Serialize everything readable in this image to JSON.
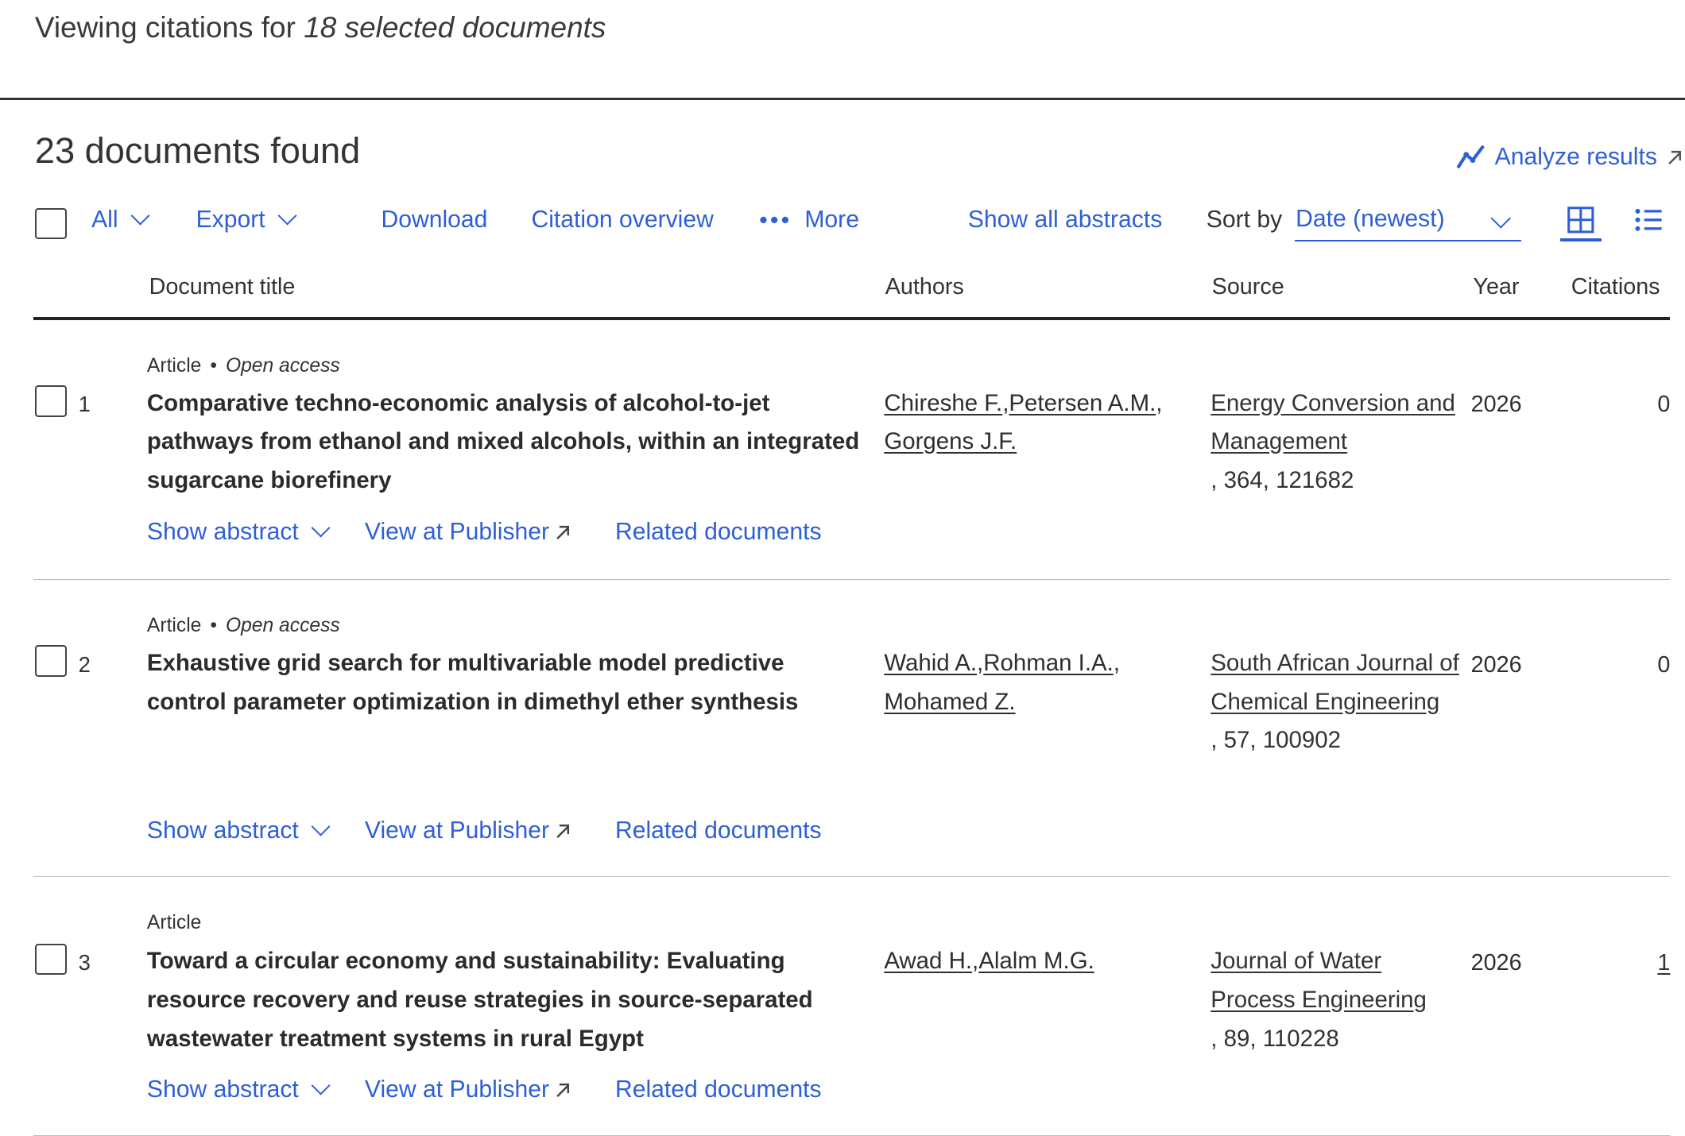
{
  "header": {
    "viewing_prefix": "Viewing citations for",
    "viewing_count": "18 selected documents",
    "found": "23 documents found",
    "analyze": "Analyze results"
  },
  "toolbar": {
    "all": "All",
    "export": "Export",
    "download": "Download",
    "citation_overview": "Citation overview",
    "more": "More",
    "show_all_abstracts": "Show all abstracts",
    "sort_label": "Sort by",
    "sort_value": "Date (newest)"
  },
  "columns": {
    "title": "Document title",
    "authors": "Authors",
    "source": "Source",
    "year": "Year",
    "citations": "Citations"
  },
  "actions": {
    "show_abstract": "Show abstract",
    "view_publisher": "View at Publisher",
    "related": "Related documents"
  },
  "rows": [
    {
      "num": "1",
      "type": "Article",
      "access": "Open access",
      "title": "Comparative techno-economic analysis of alcohol-to-jet pathways from ethanol and mixed alcohols, within an integrated sugarcane biorefinery",
      "authors": [
        "Chireshe F.",
        "Petersen A.M.",
        "Gorgens J.F."
      ],
      "source": "Energy Conversion and Management",
      "source_detail": ", 364, 121682",
      "year": "2026",
      "citations": "0"
    },
    {
      "num": "2",
      "type": "Article",
      "access": "Open access",
      "title": "Exhaustive grid search for multivariable model predictive control parameter optimization in dimethyl ether synthesis",
      "authors": [
        "Wahid A.",
        "Rohman I.A.",
        "Mohamed Z."
      ],
      "source": "South African Journal of Chemical Engineering",
      "source_detail": ", 57, 100902",
      "year": "2026",
      "citations": "0"
    },
    {
      "num": "3",
      "type": "Article",
      "access": "",
      "title": "Toward a circular economy and sustainability: Evaluating resource recovery and reuse strategies in source-separated wastewater treatment systems in rural Egypt",
      "authors": [
        "Awad H.",
        "Alalm M.G."
      ],
      "source": "Journal of Water Process Engineering",
      "source_detail": ", 89, 110228",
      "year": "2026",
      "citations": "1"
    }
  ]
}
